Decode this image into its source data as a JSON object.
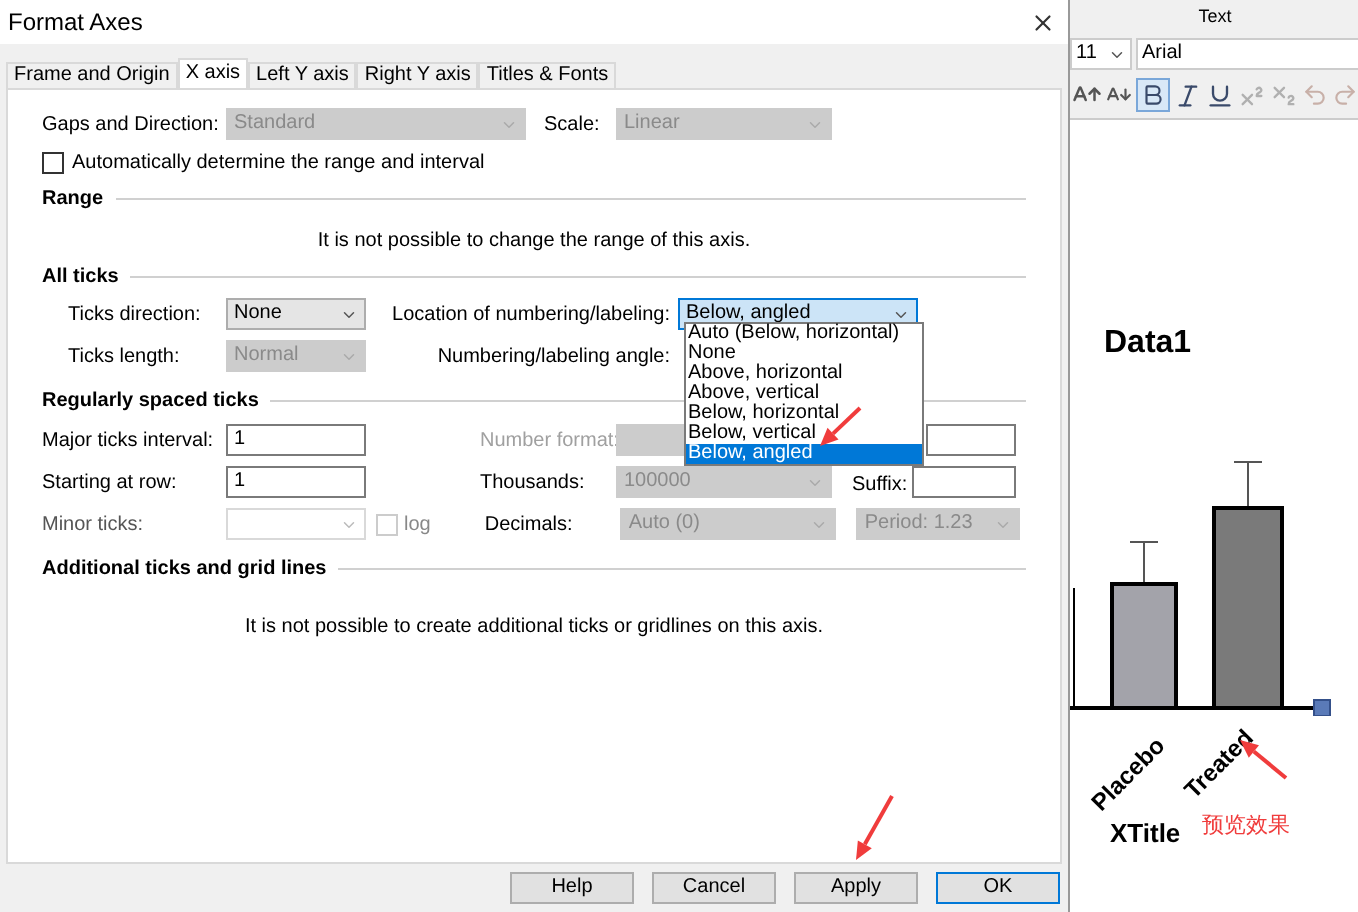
{
  "window": {
    "title": "Format Axes"
  },
  "tabs": [
    {
      "label": "Frame and Origin",
      "selected": false
    },
    {
      "label": "X axis",
      "selected": true
    },
    {
      "label": "Left Y axis",
      "selected": false
    },
    {
      "label": "Right Y axis",
      "selected": false
    },
    {
      "label": "Titles & Fonts",
      "selected": false
    }
  ],
  "top": {
    "gaps": {
      "label": "Gaps and Direction:",
      "value": "Standard",
      "disabled": true
    },
    "scale": {
      "label": "Scale:",
      "value": "Linear",
      "disabled": true
    },
    "auto_range": {
      "label": "Automatically determine the range and interval",
      "checked": false
    }
  },
  "range": {
    "heading": "Range",
    "note": "It is not possible to change the range of this axis."
  },
  "all_ticks": {
    "heading": "All ticks",
    "ticks_direction": {
      "label": "Ticks direction:",
      "value": "None",
      "disabled": false
    },
    "ticks_length": {
      "label": "Ticks length:",
      "value": "Normal",
      "disabled": true
    },
    "location": {
      "label": "Location of numbering/labeling:",
      "value": "Below, angled",
      "expanded": true,
      "options": [
        {
          "label": "Auto (Below, horizontal)",
          "selected": false
        },
        {
          "label": "None",
          "selected": false
        },
        {
          "label": "Above, horizontal",
          "selected": false
        },
        {
          "label": "Above, vertical",
          "selected": false
        },
        {
          "label": "Below, horizontal",
          "selected": false
        },
        {
          "label": "Below, vertical",
          "selected": false
        },
        {
          "label": "Below, angled",
          "selected": true
        }
      ]
    },
    "angle": {
      "label": "Numbering/labeling angle:"
    }
  },
  "regular": {
    "heading": "Regularly spaced ticks",
    "major": {
      "label": "Major ticks interval:",
      "value": "1"
    },
    "start": {
      "label": "Starting at row:",
      "value": "1"
    },
    "minor": {
      "label": "Minor ticks:",
      "disabled": true
    },
    "log": {
      "label": "log",
      "checked": false,
      "disabled": true
    },
    "number_format": {
      "label": "Number format:",
      "disabled": true
    },
    "thousands": {
      "label": "Thousands:",
      "value": "100000",
      "disabled": true
    },
    "decimals": {
      "label": "Decimals:",
      "value": "Auto (0)",
      "disabled": true
    },
    "suffix": {
      "label": "Suffix:"
    },
    "period": {
      "value": "Period: 1.23",
      "disabled": true
    }
  },
  "additional": {
    "heading": "Additional ticks and grid lines",
    "note": "It is not possible to create additional ticks or gridlines on this axis."
  },
  "buttons": [
    {
      "label": "Help",
      "default": false
    },
    {
      "label": "Cancel",
      "default": false
    },
    {
      "label": "Apply",
      "default": false
    },
    {
      "label": "OK",
      "default": true
    }
  ],
  "side_panel": {
    "header": "Text",
    "font_size": "11",
    "font_name": "Arial"
  },
  "graph": {
    "title": "Data1",
    "x_title": "XTitle",
    "bars": [
      {
        "label": "Placebo",
        "color": "#a3a3aa"
      },
      {
        "label": "Treated",
        "color": "#7a7a7a"
      }
    ]
  },
  "annotation": {
    "text": "预览效果"
  }
}
